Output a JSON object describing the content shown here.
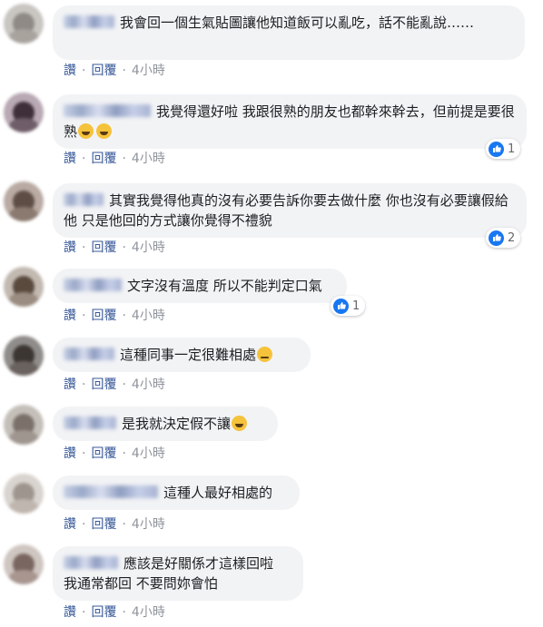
{
  "actions": {
    "like": "讚",
    "reply": "回覆",
    "separator": "·"
  },
  "comments": [
    {
      "text": "我會回一個生氣貼圖讓他知道飯可以亂吃，話不能亂說……",
      "time": "4小時",
      "reactions": null
    },
    {
      "text": "我覺得還好啦 我跟很熟的朋友也都幹來幹去，但前提是要很熟",
      "time": "4小時",
      "reactions": "1",
      "emoji": [
        "laugh-cry-emoji",
        "laugh-cry-emoji"
      ]
    },
    {
      "text": "其實我覺得他真的沒有必要告訴你要去做什麼 你也沒有必要讓假給他 只是他回的方式讓你覺得不禮貌",
      "time": "4小時",
      "reactions": "2"
    },
    {
      "text": "文字沒有溫度 所以不能判定口氣",
      "time": "4小時",
      "reactions": "1"
    },
    {
      "text": "這種同事一定很難相處",
      "time": "4小時",
      "reactions": null,
      "emoji": [
        "worried-emoji"
      ]
    },
    {
      "text": "是我就決定假不讓",
      "time": "4小時",
      "reactions": null,
      "emoji": [
        "laugh-cry-emoji"
      ]
    },
    {
      "text": "這種人最好相處的",
      "time": "4小時",
      "reactions": null
    },
    {
      "text": "應該是好關係才這樣回啦\n我通常都回 不要問妳會怕",
      "line1": "應該是好關係才這樣回啦",
      "line2": "我通常都回 不要問妳會怕",
      "time": "4小時",
      "reactions": null
    }
  ]
}
